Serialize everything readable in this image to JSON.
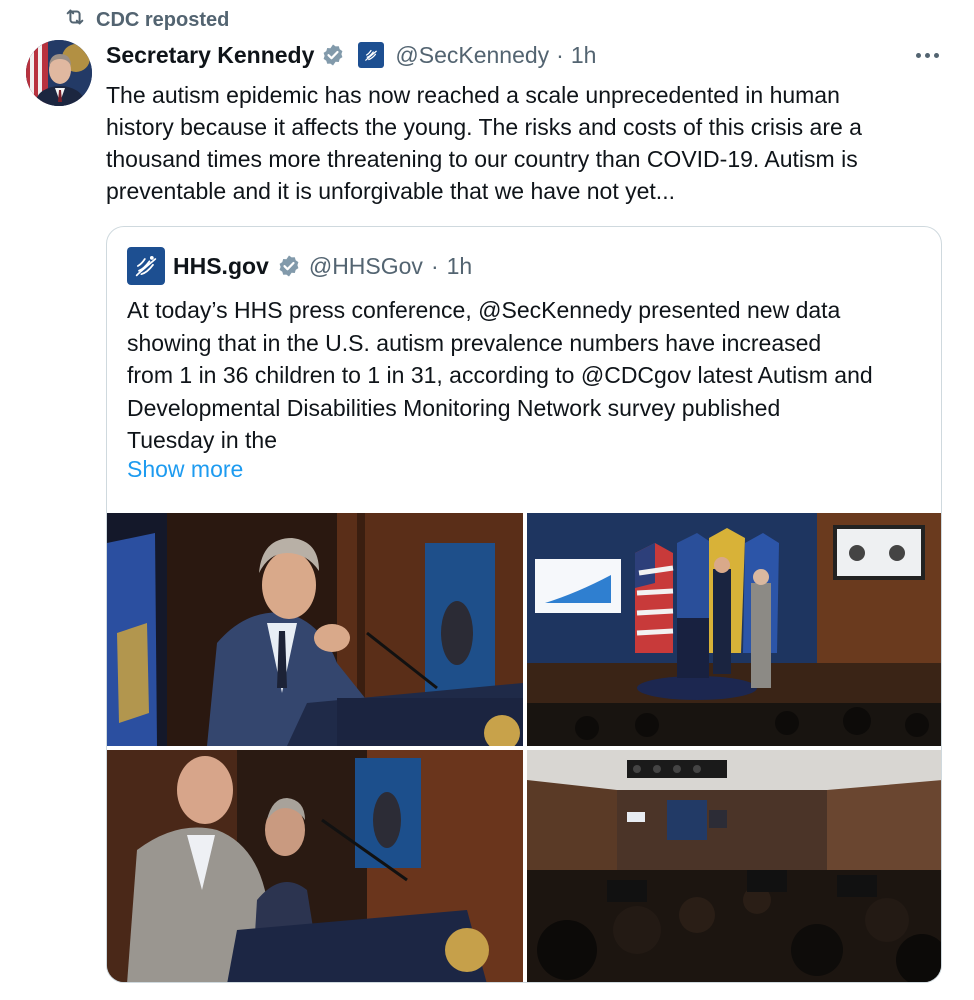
{
  "repost": {
    "label": "CDC reposted",
    "icon": "repost-icon"
  },
  "author": {
    "name": "Secretary Kennedy",
    "handle": "@SecKennedy",
    "separator": "·",
    "time": "1h",
    "verified_color": "#829aab",
    "gov_badge_color": "#1d4f91"
  },
  "tweet": {
    "lines": [
      "The autism epidemic has now reached a scale unprecedented in human",
      "history because it affects the young. The risks and costs of this crisis are a",
      "thousand times more threatening to our country than COVID-19. Autism is",
      "preventable and it is unforgivable that we have not yet..."
    ]
  },
  "quote": {
    "name": "HHS.gov",
    "handle": "@HHSGov",
    "separator": "·",
    "time": "1h",
    "lines": [
      "At today’s HHS press conference, @SecKennedy presented new data",
      "showing that in the U.S. autism prevalence numbers have increased",
      "from 1 in 36 children to 1 in 31, according to @CDCgov latest Autism and",
      "Developmental Disabilities Monitoring Network survey published",
      "Tuesday in the"
    ],
    "show_more": "Show more",
    "link_color": "#1d9bf0"
  },
  "media": {
    "count": 4
  }
}
